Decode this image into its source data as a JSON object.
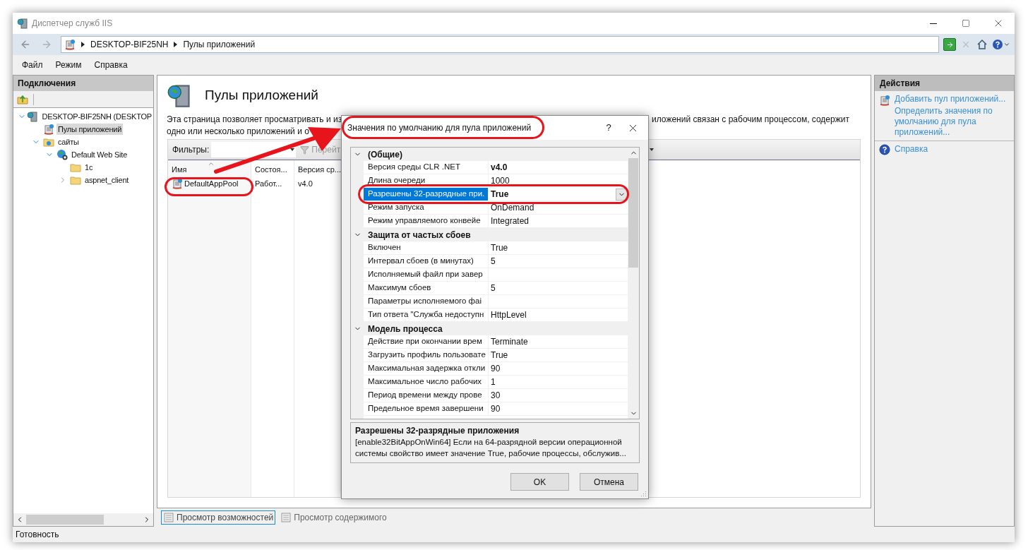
{
  "window": {
    "title": "Диспетчер служб IIS"
  },
  "breadcrumbs": [
    "DESKTOP-BIF25NH",
    "Пулы приложений"
  ],
  "menu": [
    "Файл",
    "Режим",
    "Справка"
  ],
  "connections": {
    "title": "Подключения",
    "tree": [
      {
        "label": "DESKTOP-BIF25NH (DESKTOP",
        "kind": "server",
        "expanded": true,
        "selected": false,
        "children": [
          {
            "label": "Пулы приложений",
            "kind": "pool",
            "selected": true
          },
          {
            "label": "сайты",
            "kind": "sites",
            "expanded": true,
            "selected": false,
            "children": [
              {
                "label": "Default Web Site",
                "kind": "globe",
                "expanded": true,
                "selected": false,
                "children": [
                  {
                    "label": "1c",
                    "kind": "folder",
                    "selected": false
                  },
                  {
                    "label": "aspnet_client",
                    "kind": "folder",
                    "expanded": false,
                    "selected": false
                  }
                ]
              }
            ]
          }
        ]
      }
    ]
  },
  "page": {
    "title": "Пулы приложений",
    "description_left": [
      "Эта страница позволяет просматривать и из",
      "одно или несколько приложений и о"
    ],
    "description_right": "иложений связан с рабочим процессом, содержит",
    "filter_label": "Фильтры:",
    "go_button": "Перейт",
    "columns": [
      "Имя",
      "Состоя...",
      "Версия ср..."
    ],
    "rows": [
      {
        "cells": [
          "DefaultAppPool",
          "Работ...",
          "v4.0"
        ],
        "selected": false
      }
    ]
  },
  "view_tabs": [
    {
      "label": "Просмотр возможностей",
      "selected": true
    },
    {
      "label": "Просмотр содержимого",
      "selected": false
    }
  ],
  "actions": {
    "title": "Действия",
    "groups": [
      [
        {
          "label": "Добавить пул приложений...",
          "kind": "add"
        },
        {
          "label": "Определить значения по умолчанию для пула приложений...",
          "kind": "plain"
        }
      ],
      [
        {
          "label": "Справка",
          "kind": "help"
        }
      ]
    ]
  },
  "status": "Готовность",
  "dialog": {
    "title": "Значения по умолчанию для пула приложений",
    "help": "?",
    "groups": [
      {
        "label": "(Общие)",
        "expanded": true,
        "properties": [
          {
            "name": "Версия среды CLR .NET",
            "value": "v4.0",
            "modified": true,
            "selected": false
          },
          {
            "name": "Длина очереди",
            "value": "1000",
            "modified": false,
            "selected": false
          },
          {
            "name": "Разрешены 32-разрядные при.",
            "value": "True",
            "modified": true,
            "selected": true
          },
          {
            "name": "Режим запуска",
            "value": "OnDemand",
            "modified": false,
            "selected": false
          },
          {
            "name": "Режим управляемого конвейе",
            "value": "Integrated",
            "modified": false,
            "selected": false
          }
        ]
      },
      {
        "label": "Защита от частых сбоев",
        "expanded": true,
        "properties": [
          {
            "name": "Включен",
            "value": "True",
            "modified": false,
            "selected": false
          },
          {
            "name": "Интервал сбоев (в минутах)",
            "value": "5",
            "modified": false,
            "selected": false
          },
          {
            "name": "Исполняемый файл при завер",
            "selected": false
          },
          {
            "name": "Максимум сбоев",
            "value": "5",
            "modified": false,
            "selected": false
          },
          {
            "name": "Параметры исполняемого фаі",
            "selected": false
          },
          {
            "name": "Тип ответа \"Служба недоступн",
            "value": "HttpLevel",
            "modified": false,
            "selected": false
          }
        ]
      },
      {
        "label": "Модель процесса",
        "expanded": true,
        "properties": [
          {
            "name": "Действие при окончании врем",
            "value": "Terminate",
            "modified": false,
            "selected": false
          },
          {
            "name": "Загрузить профиль пользовате",
            "value": "True",
            "modified": false,
            "selected": false
          },
          {
            "name": "Максимальная задержка откли",
            "value": "90",
            "modified": false,
            "selected": false
          },
          {
            "name": "Максимальное число рабочих",
            "value": "1",
            "modified": false,
            "selected": false
          },
          {
            "name": "Период времени между прове",
            "value": "30",
            "modified": false,
            "selected": false
          },
          {
            "name": "Предельное время завершени",
            "value": "90",
            "modified": false,
            "selected": false
          }
        ]
      }
    ],
    "description": {
      "title": "Разрешены 32-разрядные приложения",
      "text": "[enable32BitAppOnWin64] Если на 64-разрядной версии операционной системы свойство имеет значение True, рабочие процессы, обслужив..."
    },
    "buttons": [
      "OK",
      "Отмена"
    ]
  }
}
